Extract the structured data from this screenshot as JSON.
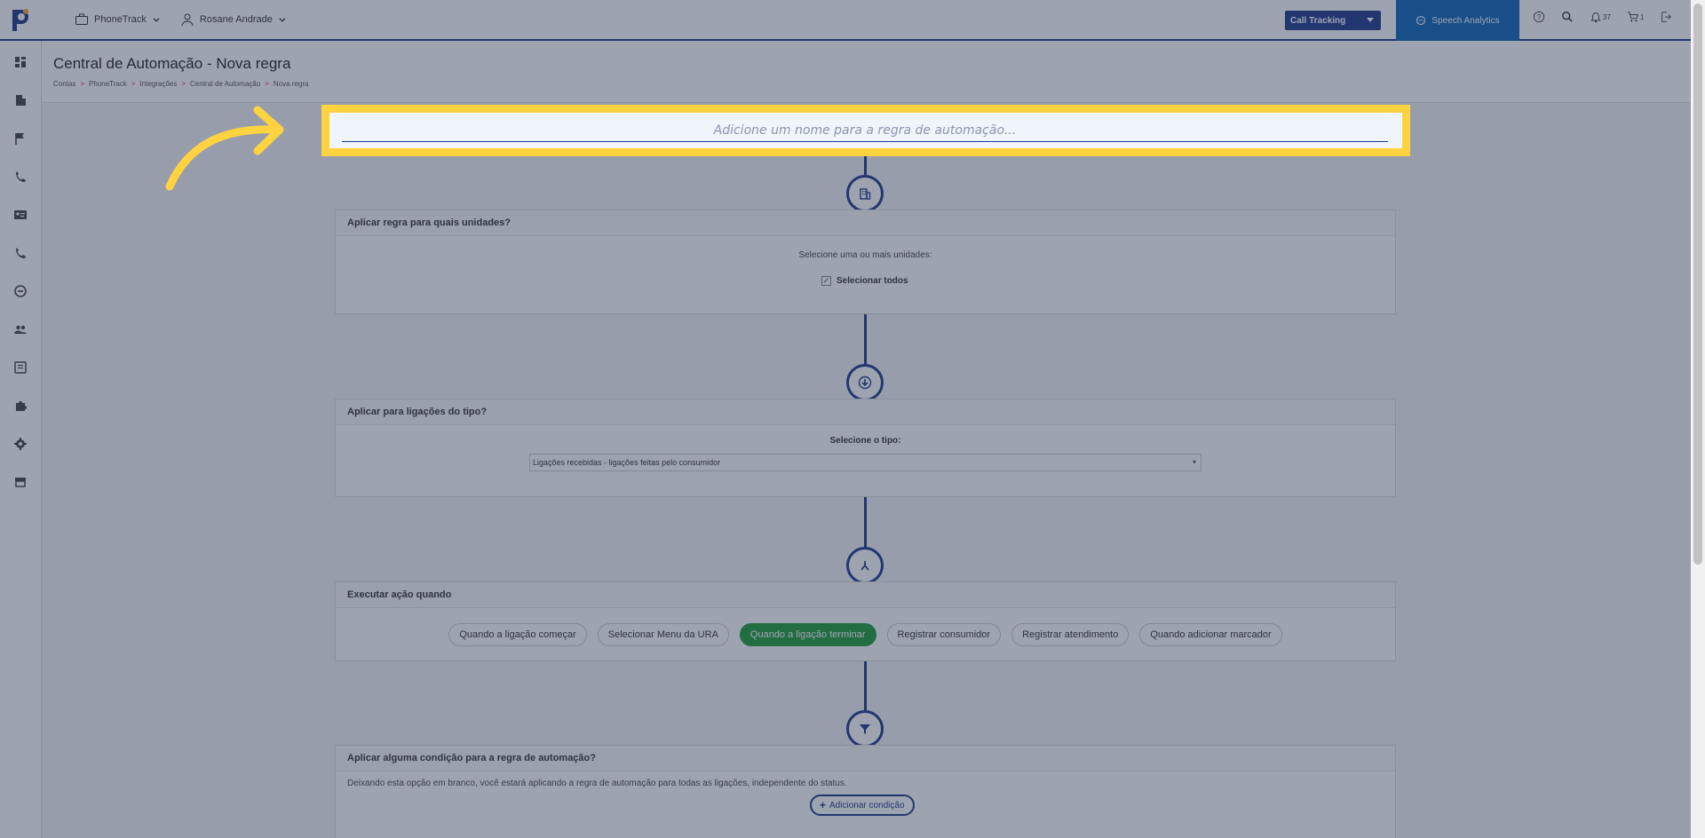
{
  "header": {
    "account_menu": "PhoneTrack",
    "user_menu": "Rosane Andrade",
    "product_select": "Call Tracking",
    "speech_analytics": "Speech Analytics",
    "notifications_count": "37",
    "cart_count": "1"
  },
  "page": {
    "title": "Central de Automação - Nova regra",
    "breadcrumb": [
      "Contas",
      "PhoneTrack",
      "Integrações",
      "Central de Automação",
      "Nova regra"
    ]
  },
  "form": {
    "name_placeholder": "Adicione um nome para a regra de automação...",
    "units": {
      "title": "Aplicar regra para quais unidades?",
      "prompt": "Selecione uma ou mais unidades:",
      "select_all": "Selecionar todos"
    },
    "call_type": {
      "title": "Aplicar para ligações do tipo?",
      "prompt": "Selecione o tipo:",
      "selected": "Ligações recebidas - ligações feitas pelo consumidor"
    },
    "trigger": {
      "title": "Executar ação quando",
      "options": [
        "Quando a ligação começar",
        "Selecionar Menu da URA",
        "Quando a ligação terminar",
        "Registrar consumidor",
        "Registrar atendimento",
        "Quando adicionar marcador"
      ],
      "active_index": 2
    },
    "condition": {
      "title": "Aplicar alguma condição para a regra de automação?",
      "description": "Deixando esta opção em branco, você estará aplicando a regra de automação para todas as ligações, independente do status.",
      "add_button": "Adicionar condição"
    }
  },
  "colors": {
    "primary": "#1e3a8a",
    "speech_bg": "#0b66b8",
    "active_pill": "#1f9d3a",
    "highlight": "#ffd23f"
  }
}
